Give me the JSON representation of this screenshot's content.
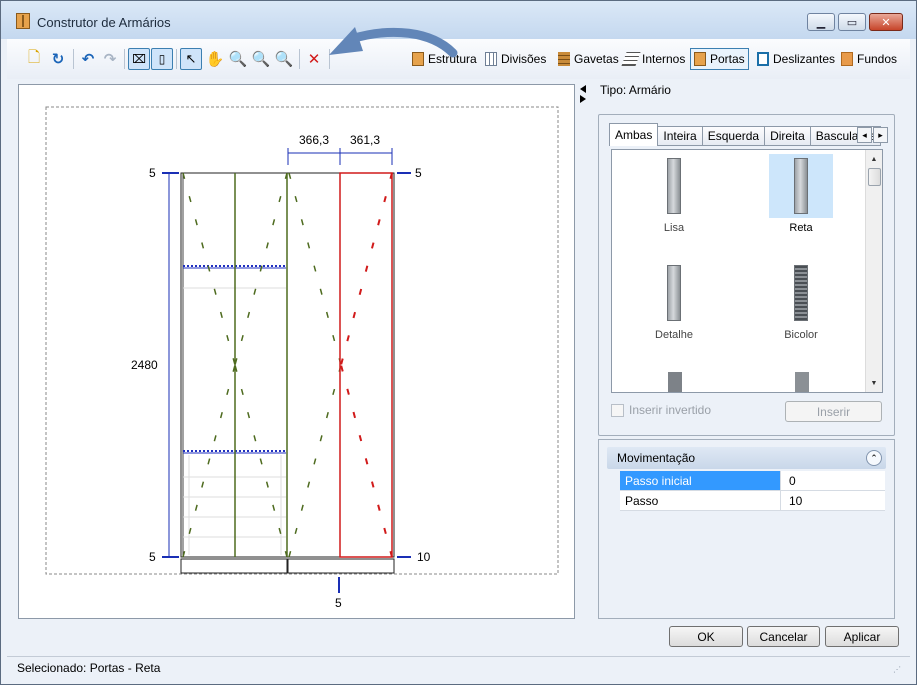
{
  "window": {
    "title": "Construtor de Armários"
  },
  "toolbar": {
    "categories": [
      {
        "label": "Estrutura",
        "icon": "estrutura-icon",
        "color": "#d98a2b"
      },
      {
        "label": "Divisões",
        "icon": "divisoes-icon",
        "color": "#7a8aa0"
      },
      {
        "label": "Gavetas",
        "icon": "gavetas-icon",
        "color": "#c98b3a"
      },
      {
        "label": "Internos",
        "icon": "internos-icon",
        "color": "#555555"
      },
      {
        "label": "Portas",
        "icon": "portas-icon",
        "color": "#e0a050",
        "active": true
      },
      {
        "label": "Deslizantes",
        "icon": "deslizantes-icon",
        "color": "#1b6fa8"
      },
      {
        "label": "Fundos",
        "icon": "fundos-icon",
        "color": "#e89a4a"
      }
    ]
  },
  "drawing": {
    "dim_top_left": "366,3",
    "dim_top_right": "361,3",
    "dim_left_height": "2480",
    "margin_top_left": "5",
    "margin_top_right": "5",
    "margin_bottom_left": "5",
    "margin_bottom_right": "10",
    "margin_bottom_center": "5",
    "colors": {
      "door_left": "#4e6b1f",
      "door_right": "#d11a1a",
      "dimension": "#1a2fb5",
      "shelf": "#2030c0"
    }
  },
  "panel": {
    "tipo": "Tipo: Armário",
    "tabs": [
      "Ambas",
      "Inteira",
      "Esquerda",
      "Direita",
      "Basculante"
    ],
    "active_tab": "Ambas",
    "doors": [
      {
        "label": "Lisa",
        "selected": false
      },
      {
        "label": "Reta",
        "selected": true
      },
      {
        "label": "Detalhe",
        "selected": false
      },
      {
        "label": "Bicolor",
        "selected": false
      }
    ],
    "insert_inverted_label": "Inserir invertido",
    "insert_button": "Inserir"
  },
  "movement": {
    "header": "Movimentação",
    "rows": [
      {
        "key": "Passo inicial",
        "value": "0"
      },
      {
        "key": "Passo",
        "value": "10"
      }
    ]
  },
  "buttons": {
    "ok": "OK",
    "cancel": "Cancelar",
    "apply": "Aplicar"
  },
  "status": "Selecionado: Portas - Reta"
}
